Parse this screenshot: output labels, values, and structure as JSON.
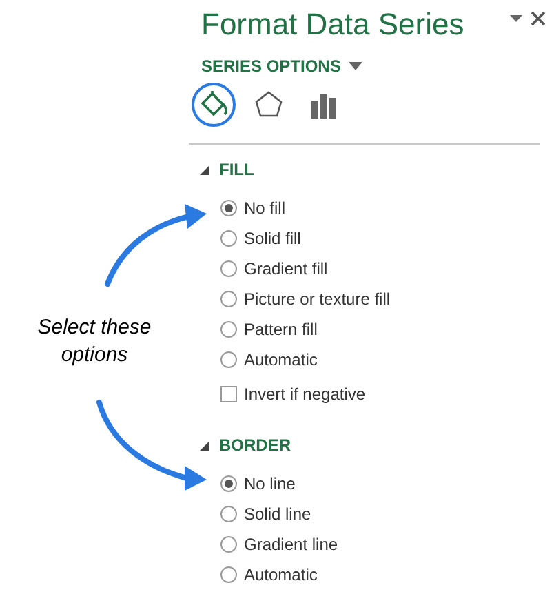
{
  "pane": {
    "title": "Format Data Series",
    "menu": "SERIES OPTIONS"
  },
  "tabs": [
    {
      "kind": "fill",
      "selected": true
    },
    {
      "kind": "effects",
      "selected": false
    },
    {
      "kind": "options",
      "selected": false
    }
  ],
  "sections": [
    {
      "title": "FILL",
      "expanded": true,
      "items": [
        {
          "kind": "radio",
          "label": "No fill",
          "selected": true
        },
        {
          "kind": "radio",
          "label": "Solid fill",
          "selected": false
        },
        {
          "kind": "radio",
          "label": "Gradient fill",
          "selected": false
        },
        {
          "kind": "radio",
          "label": "Picture or texture fill",
          "selected": false
        },
        {
          "kind": "radio",
          "label": "Pattern fill",
          "selected": false
        },
        {
          "kind": "radio",
          "label": "Automatic",
          "selected": false
        },
        {
          "kind": "checkbox",
          "label": "Invert if negative",
          "checked": false
        }
      ]
    },
    {
      "title": "BORDER",
      "expanded": true,
      "items": [
        {
          "kind": "radio",
          "label": "No line",
          "selected": true
        },
        {
          "kind": "radio",
          "label": "Solid line",
          "selected": false
        },
        {
          "kind": "radio",
          "label": "Gradient line",
          "selected": false
        },
        {
          "kind": "radio",
          "label": "Automatic",
          "selected": false
        }
      ]
    }
  ],
  "annotation": {
    "text": "Select these options"
  }
}
